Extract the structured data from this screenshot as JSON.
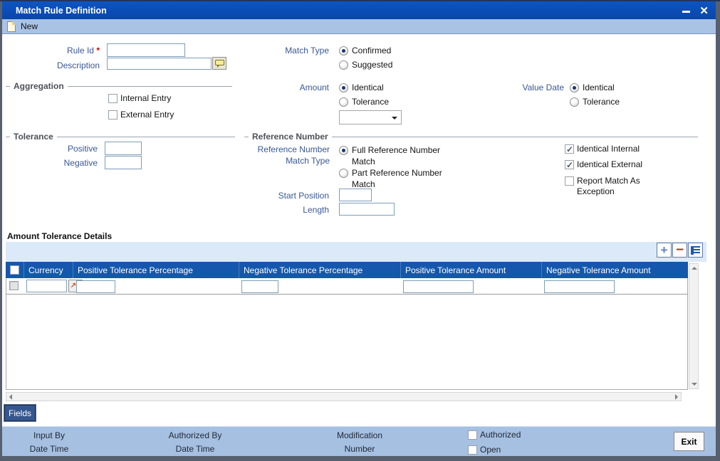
{
  "window": {
    "title": "Match Rule Definition"
  },
  "toolbar": {
    "new_label": "New"
  },
  "form": {
    "rule_id_label": "Rule Id",
    "required_marker": "*",
    "rule_id_value": "",
    "description_label": "Description",
    "description_value": "",
    "match_type": {
      "label": "Match Type",
      "options": [
        {
          "label": "Confirmed",
          "selected": true
        },
        {
          "label": "Suggested",
          "selected": false
        }
      ]
    },
    "aggregation": {
      "title": "Aggregation",
      "options": [
        {
          "label": "Internal Entry",
          "checked": false
        },
        {
          "label": "External Entry",
          "checked": false
        }
      ]
    },
    "amount": {
      "label": "Amount",
      "options": [
        {
          "label": "Identical",
          "selected": true
        },
        {
          "label": "Tolerance",
          "selected": false
        }
      ],
      "dropdown_value": ""
    },
    "value_date": {
      "label": "Value Date",
      "options": [
        {
          "label": "Identical",
          "selected": true
        },
        {
          "label": "Tolerance",
          "selected": false
        }
      ]
    },
    "tolerance": {
      "title": "Tolerance",
      "positive_label": "Positive",
      "positive_value": "",
      "negative_label": "Negative",
      "negative_value": ""
    },
    "reference_number": {
      "title": "Reference Number",
      "match_type_label": "Reference Number Match Type",
      "options": [
        {
          "label": "Full Reference Number Match",
          "selected": true
        },
        {
          "label": "Part Reference Number Match",
          "selected": false
        }
      ],
      "start_position_label": "Start Position",
      "start_position_value": "",
      "length_label": "Length",
      "length_value": ""
    },
    "flags": [
      {
        "label": "Identical Internal",
        "checked": true
      },
      {
        "label": "Identical External",
        "checked": true
      },
      {
        "label": "Report Match As Exception",
        "checked": false
      }
    ]
  },
  "table": {
    "title": "Amount Tolerance Details",
    "columns": [
      "Currency",
      "Positive Tolerance Percentage",
      "Negative Tolerance Percentage",
      "Positive Tolerance Amount",
      "Negative Tolerance Amount"
    ],
    "row": {
      "checked": false,
      "currency": "",
      "positive_pct": "",
      "negative_pct": "",
      "positive_amt": "",
      "negative_amt": ""
    }
  },
  "actions": {
    "fields_label": "Fields",
    "exit_label": "Exit"
  },
  "footer": {
    "input_by_label": "Input By",
    "input_date_label": "Date Time",
    "authorized_by_label": "Authorized By",
    "authorized_date_label": "Date Time",
    "modification_label": "Modification Number",
    "flags": [
      {
        "label": "Authorized",
        "checked": false
      },
      {
        "label": "Open",
        "checked": false
      }
    ]
  },
  "colors": {
    "titlebar": "#0a4ab4",
    "panel_blue": "#a6c0e2",
    "table_header": "#1557ac",
    "label_blue": "#3a5795",
    "frame": "#57606f"
  }
}
